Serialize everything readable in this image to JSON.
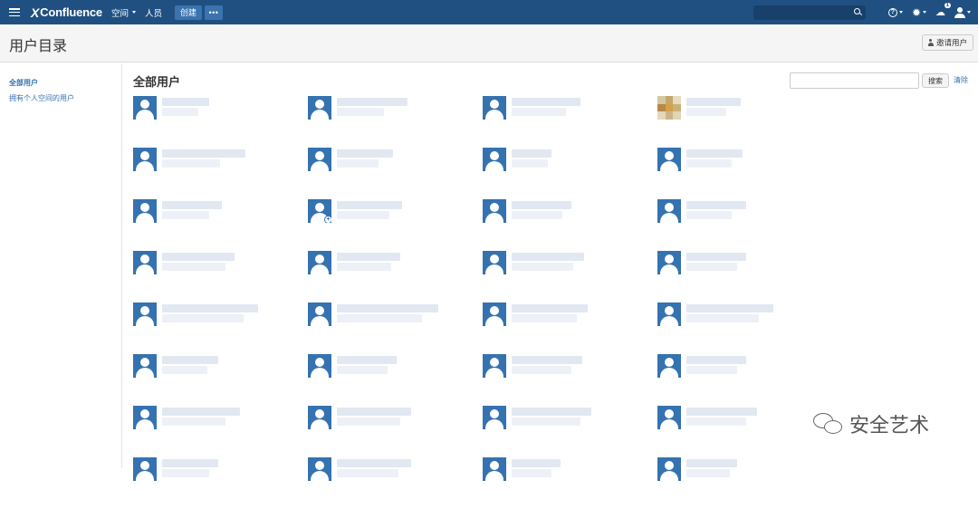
{
  "nav": {
    "logo_text": "Confluence",
    "logo_mark": "X",
    "spaces_label": "空间",
    "people_label": "人员",
    "create_label": "创建",
    "more_label": "•••",
    "notif_count": "1",
    "brand_color": "#205081"
  },
  "header": {
    "title": "用户目录",
    "invite_label": "邀请用户"
  },
  "sidebar": {
    "items": [
      {
        "label": "全部用户"
      },
      {
        "label": "拥有个人空间的用户"
      }
    ]
  },
  "main": {
    "section_title": "全部用户",
    "search_button": "搜索",
    "clear_link": "清除",
    "link_color": "#3572b0"
  },
  "users": [
    {
      "avatar": "default"
    },
    {
      "avatar": "default"
    },
    {
      "avatar": "default"
    },
    {
      "avatar": "photo"
    },
    {
      "avatar": "default"
    },
    {
      "avatar": "default"
    },
    {
      "avatar": "default"
    },
    {
      "avatar": "default"
    },
    {
      "avatar": "default"
    },
    {
      "avatar": "default-plus"
    },
    {
      "avatar": "default"
    },
    {
      "avatar": "default"
    },
    {
      "avatar": "default"
    },
    {
      "avatar": "default"
    },
    {
      "avatar": "default"
    },
    {
      "avatar": "default"
    },
    {
      "avatar": "default"
    },
    {
      "avatar": "default"
    },
    {
      "avatar": "default"
    },
    {
      "avatar": "default"
    },
    {
      "avatar": "default"
    },
    {
      "avatar": "default"
    },
    {
      "avatar": "default"
    },
    {
      "avatar": "default"
    },
    {
      "avatar": "default"
    },
    {
      "avatar": "default"
    },
    {
      "avatar": "default"
    },
    {
      "avatar": "default"
    },
    {
      "avatar": "default"
    },
    {
      "avatar": "default"
    },
    {
      "avatar": "default"
    },
    {
      "avatar": "default"
    }
  ],
  "watermark": {
    "text": "安全艺术",
    "icon": "wechat-icon"
  }
}
